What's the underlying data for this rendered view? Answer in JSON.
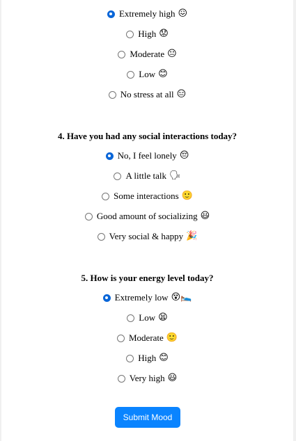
{
  "q3": {
    "options": [
      {
        "label": "Extremely high",
        "emoji": "😖",
        "checked": true
      },
      {
        "label": "High",
        "emoji": "😟",
        "checked": false
      },
      {
        "label": "Moderate",
        "emoji": "😐",
        "checked": false
      },
      {
        "label": "Low",
        "emoji": "😊",
        "checked": false
      },
      {
        "label": "No stress at all",
        "emoji": "😑",
        "checked": false
      }
    ]
  },
  "q4": {
    "title": "4. Have you had any social interactions today?",
    "options": [
      {
        "label": "No, I feel lonely",
        "emoji": "😔",
        "checked": true
      },
      {
        "label": "A little talk",
        "emoji": "🗣",
        "checked": false
      },
      {
        "label": "Some interactions",
        "emoji": "🙂",
        "checked": false
      },
      {
        "label": "Good amount of socializing",
        "emoji": "😃",
        "checked": false
      },
      {
        "label": "Very social & happy",
        "emoji": "🎉",
        "checked": false
      }
    ]
  },
  "q5": {
    "title": "5. How is your energy level today?",
    "options": [
      {
        "label": "Extremely low",
        "emoji": "😵🛌",
        "checked": true
      },
      {
        "label": "Low",
        "emoji": "😫",
        "checked": false
      },
      {
        "label": "Moderate",
        "emoji": "🙂",
        "checked": false
      },
      {
        "label": "High",
        "emoji": "😊",
        "checked": false
      },
      {
        "label": "Very high",
        "emoji": "😃",
        "checked": false
      }
    ]
  },
  "submit_label": "Submit Mood",
  "colors": {
    "accent": "#0a84ff",
    "radio_checked": "#0a66d8"
  }
}
